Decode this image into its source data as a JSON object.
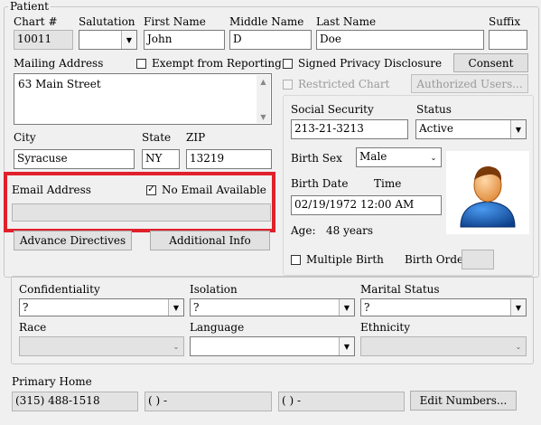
{
  "patient": {
    "legend": "Patient",
    "chart_label": "Chart #",
    "chart_value": "10011",
    "salutation_label": "Salutation",
    "salutation_value": "",
    "first_label": "First Name",
    "first_value": "John",
    "middle_label": "Middle Name",
    "middle_value": "D",
    "last_label": "Last Name",
    "last_value": "Doe",
    "suffix_label": "Suffix",
    "suffix_value": "",
    "mailing_label": "Mailing Address",
    "mailing_value": "63 Main Street",
    "exempt_label": "Exempt from Reporting",
    "signed_label": "Signed Privacy Disclosure",
    "consent_label": "Consent",
    "restricted_label": "Restricted Chart",
    "authorized_label": "Authorized Users...",
    "city_label": "City",
    "city_value": "Syracuse",
    "state_label": "State",
    "state_value": "NY",
    "zip_label": "ZIP",
    "zip_value": "13219",
    "ssn_label": "Social Security",
    "ssn_value": "213-21-3213",
    "status_label": "Status",
    "status_value": "Active",
    "birthsex_label": "Birth Sex",
    "birthsex_value": "Male",
    "birthdate_label": "Birth Date",
    "time_label": "Time",
    "birthdate_value": "02/19/1972   12:00 AM",
    "age_label": "Age:",
    "age_value": "48 years",
    "email_label": "Email Address",
    "no_email_label": "No Email Available",
    "email_value": "",
    "multiple_birth_label": "Multiple Birth",
    "birth_order_label": "Birth Order",
    "birth_order_value": "",
    "advance_label": "Advance Directives",
    "additional_label": "Additional Info"
  },
  "demographics": {
    "confidentiality_label": "Confidentiality",
    "confidentiality_value": "?",
    "isolation_label": "Isolation",
    "isolation_value": "?",
    "marital_label": "Marital Status",
    "marital_value": "?",
    "race_label": "Race",
    "race_value": "",
    "language_label": "Language",
    "language_value": "",
    "ethnicity_label": "Ethnicity",
    "ethnicity_value": ""
  },
  "phone": {
    "primary_label": "Primary Home",
    "primary_value": "(315) 488-1518",
    "second_value": "(   )    -",
    "third_value": "(   )    -",
    "edit_label": "Edit Numbers..."
  },
  "icons": {
    "avatar": "person-avatar-icon",
    "dropdown": "chevron-down-icon",
    "checkbox_checked": "checkmark-icon"
  },
  "colors": {
    "highlight": "#e0202b",
    "avatar_shirt": "#1a5fb4",
    "avatar_skin": "#f0a050"
  }
}
